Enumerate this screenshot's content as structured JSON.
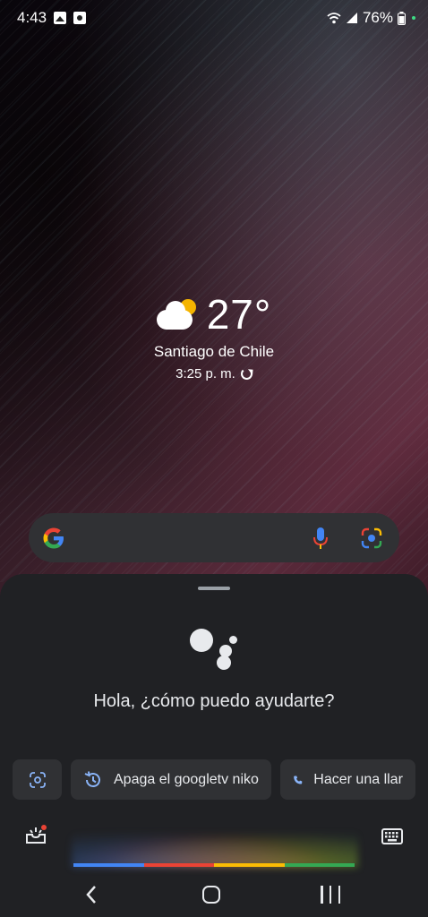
{
  "status_bar": {
    "time": "4:43",
    "battery": "76%",
    "icons": [
      "gallery-icon",
      "notification-icon",
      "wifi-icon",
      "signal-icon",
      "battery-icon"
    ]
  },
  "weather": {
    "temperature": "27°",
    "city": "Santiago de Chile",
    "updated": "3:25 p. m.",
    "icon": "partly-cloudy-icon"
  },
  "search_bar": {
    "icons": [
      "google-logo-icon",
      "mic-icon",
      "lens-icon"
    ]
  },
  "assistant": {
    "greeting": "Hola, ¿cómo puedo ayudarte?",
    "chips": [
      {
        "icon": "lens-icon"
      },
      {
        "icon": "history-icon",
        "label": "Apaga el googletv niko"
      },
      {
        "icon": "phone-icon",
        "label": "Hacer una llar"
      }
    ],
    "colors": [
      "#4285f4",
      "#ea4335",
      "#fbbc04",
      "#34a853"
    ]
  },
  "navigation": {
    "buttons": [
      "back",
      "home",
      "recents"
    ]
  }
}
